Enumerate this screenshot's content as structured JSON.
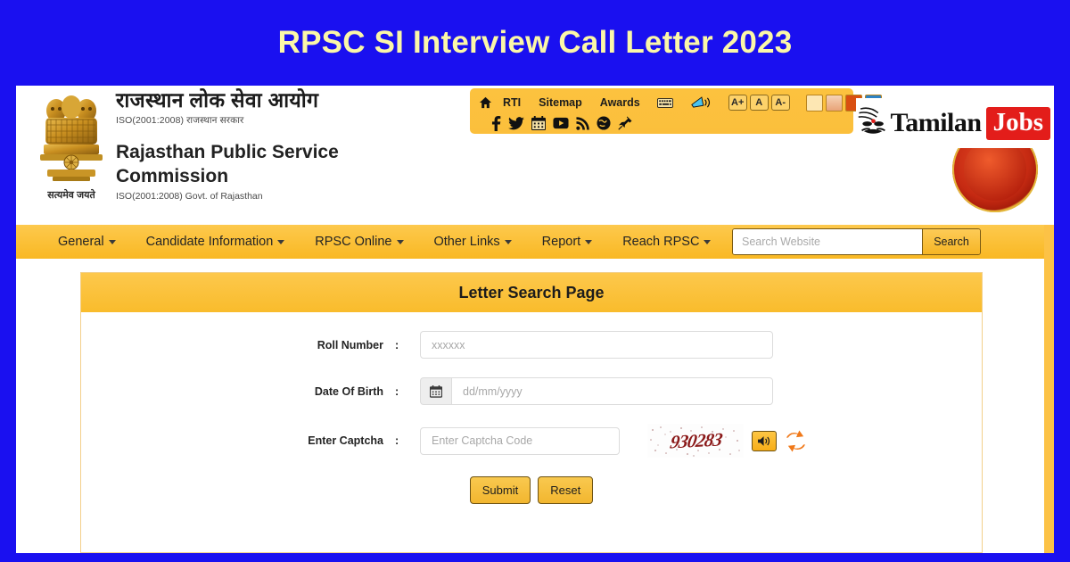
{
  "banner": {
    "title": "RPSC SI Interview Call Letter 2023",
    "bg_color": "#1a10f0",
    "text_color": "#fbf7a8"
  },
  "site_header": {
    "emblem_motto": "सत्यमेव जयते",
    "hindi_title": "राजस्थान लोक सेवा आयोग",
    "hindi_subtitle": "ISO(2001:2008) राजस्थान सरकार",
    "english_title_line1": "Rajasthan Public Service",
    "english_title_line2": "Commission",
    "english_subtitle": "ISO(2001:2008) Govt. of Rajasthan"
  },
  "accessibility_bar": {
    "home_icon": "home-icon",
    "links": [
      "RTI",
      "Sitemap",
      "Awards"
    ],
    "keyboard_icon": "keyboard-icon",
    "screen_reader_icon": "screen-reader-icon",
    "font_sizes": [
      "A+",
      "A",
      "A-"
    ],
    "theme_swatches": [
      "#fde7b3",
      "#f0b68c",
      "#d94f11",
      "#2d82c4"
    ],
    "social_icons": [
      "facebook-icon",
      "twitter-icon",
      "calendar-icon",
      "youtube-icon",
      "rss-icon",
      "globe-icon",
      "pin-icon"
    ]
  },
  "watermark": {
    "brand_part1": "Tamilan",
    "brand_part2": "Jobs",
    "jobs_bg_color": "#e31d1a"
  },
  "nav": {
    "items": [
      {
        "label": "General",
        "has_caret": true
      },
      {
        "label": "Candidate Information",
        "has_caret": true
      },
      {
        "label": "RPSC Online",
        "has_caret": true
      },
      {
        "label": "Other Links",
        "has_caret": true
      },
      {
        "label": "Report",
        "has_caret": true
      },
      {
        "label": "Reach RPSC",
        "has_caret": true
      }
    ],
    "search_placeholder": "Search Website",
    "search_value": "",
    "search_button": "Search",
    "bar_color": "#fbc02d"
  },
  "form": {
    "panel_title": "Letter Search Page",
    "fields": [
      {
        "label": "Roll Number",
        "colon": ":",
        "placeholder": "xxxxxx",
        "value": ""
      },
      {
        "label": "Date Of Birth",
        "colon": ":",
        "placeholder": "dd/mm/yyyy",
        "value": ""
      },
      {
        "label": "Enter Captcha",
        "colon": ":",
        "placeholder": "Enter Captcha Code",
        "value": ""
      }
    ],
    "captcha_code": "930283",
    "captcha_audio_icon": "speaker-icon",
    "captcha_refresh_icon": "refresh-icon",
    "calendar_icon": "calendar-icon",
    "submit_label": "Submit",
    "reset_label": "Reset"
  }
}
